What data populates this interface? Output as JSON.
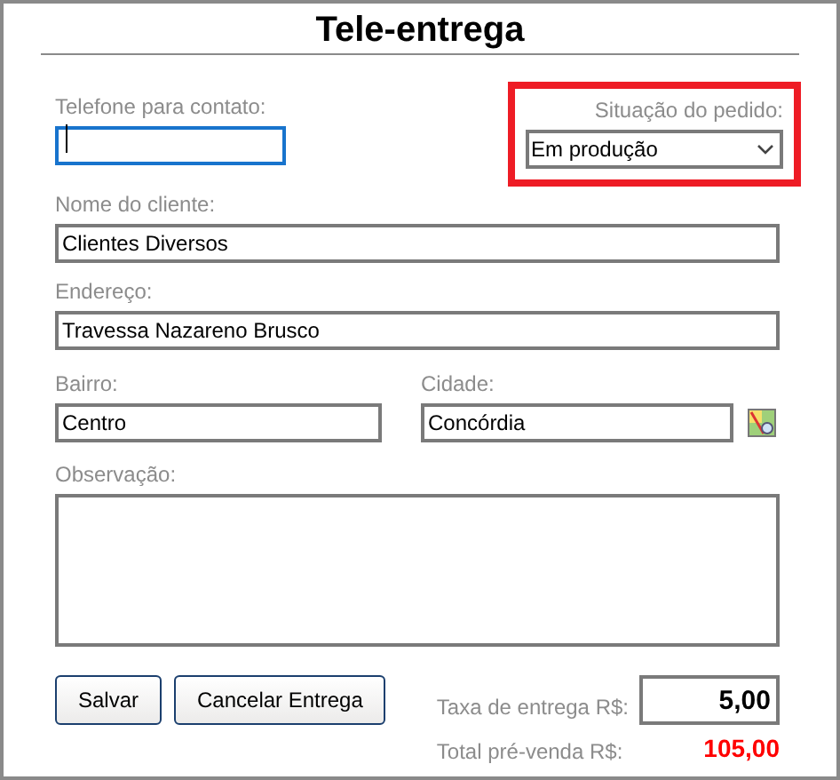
{
  "title": "Tele-entrega",
  "phone": {
    "label": "Telefone para contato:",
    "focused": true
  },
  "status": {
    "label": "Situação do pedido:",
    "value": "Em produção",
    "highlighted": true
  },
  "customer": {
    "label": "Nome do cliente:",
    "value": "Clientes Diversos"
  },
  "address": {
    "label": "Endereço:",
    "value": "Travessa Nazareno Brusco"
  },
  "district": {
    "label": "Bairro:",
    "value": "Centro"
  },
  "city": {
    "label": "Cidade:",
    "value": "Concórdia"
  },
  "notes": {
    "label": "Observação:"
  },
  "buttons": [
    "Salvar",
    "Cancelar Entrega"
  ],
  "fee": {
    "label": "Taxa de entrega R$:",
    "value": "5,00"
  },
  "total": {
    "label": "Total pré-venda R$:",
    "value": "105,00"
  }
}
